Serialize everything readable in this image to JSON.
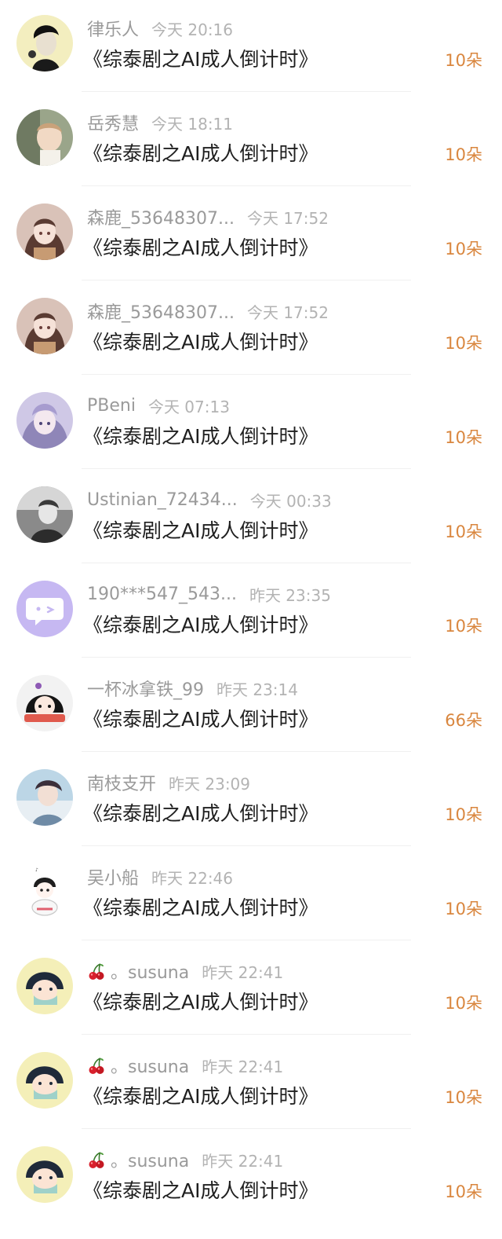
{
  "gift_records": [
    {
      "username": "律乐人",
      "time": "今天 20:16",
      "title": "《综泰剧之AI成人倒计时》",
      "amount": "10朵",
      "avatar": "avatar-person-black-white"
    },
    {
      "username": "岳秀慧",
      "time": "今天 18:11",
      "title": "《综泰剧之AI成人倒计时》",
      "amount": "10朵",
      "avatar": "avatar-baby-photo"
    },
    {
      "username": "森鹿_53648307...",
      "time": "今天 17:52",
      "title": "《综泰剧之AI成人倒计时》",
      "amount": "10朵",
      "avatar": "avatar-anime-girl"
    },
    {
      "username": "森鹿_53648307...",
      "time": "今天 17:52",
      "title": "《综泰剧之AI成人倒计时》",
      "amount": "10朵",
      "avatar": "avatar-anime-girl"
    },
    {
      "username": "PBeni",
      "time": "今天 07:13",
      "title": "《综泰剧之AI成人倒计时》",
      "amount": "10朵",
      "avatar": "avatar-anime-girl-purple"
    },
    {
      "username": "Ustinian_72434...",
      "time": "今天 00:33",
      "title": "《综泰剧之AI成人倒计时》",
      "amount": "10朵",
      "avatar": "avatar-grayscale-photo"
    },
    {
      "username": "190***547_543...",
      "time": "昨天 23:35",
      "title": "《综泰剧之AI成人倒计时》",
      "amount": "10朵",
      "avatar": "avatar-chat-bubble-default"
    },
    {
      "username": "一杯冰拿铁_99",
      "time": "昨天 23:14",
      "title": "《综泰剧之AI成人倒计时》",
      "amount": "66朵",
      "avatar": "avatar-cartoon-girl"
    },
    {
      "username": "南枝支开",
      "time": "昨天 23:09",
      "title": "《综泰剧之AI成人倒计时》",
      "amount": "10朵",
      "avatar": "avatar-photo-blue"
    },
    {
      "username": "吴小船",
      "time": "昨天 22:46",
      "title": "《综泰剧之AI成人倒计时》",
      "amount": "10朵",
      "avatar": "avatar-chibi-sketch"
    },
    {
      "username": "。susuna",
      "time": "昨天 22:41",
      "title": "《综泰剧之AI成人倒计时》",
      "amount": "10朵",
      "avatar": "avatar-cartoon-masked",
      "prefix_icon": "cherry-icon"
    },
    {
      "username": "。susuna",
      "time": "昨天 22:41",
      "title": "《综泰剧之AI成人倒计时》",
      "amount": "10朵",
      "avatar": "avatar-cartoon-masked",
      "prefix_icon": "cherry-icon"
    },
    {
      "username": "。susuna",
      "time": "昨天 22:41",
      "title": "《综泰剧之AI成人倒计时》",
      "amount": "10朵",
      "avatar": "avatar-cartoon-masked",
      "prefix_icon": "cherry-icon"
    }
  ],
  "colors": {
    "username": "#9a9a9a",
    "time": "#b3b3b3",
    "title": "#1f1f1f",
    "amount": "#d9863e",
    "divider": "#f0f0f0"
  }
}
